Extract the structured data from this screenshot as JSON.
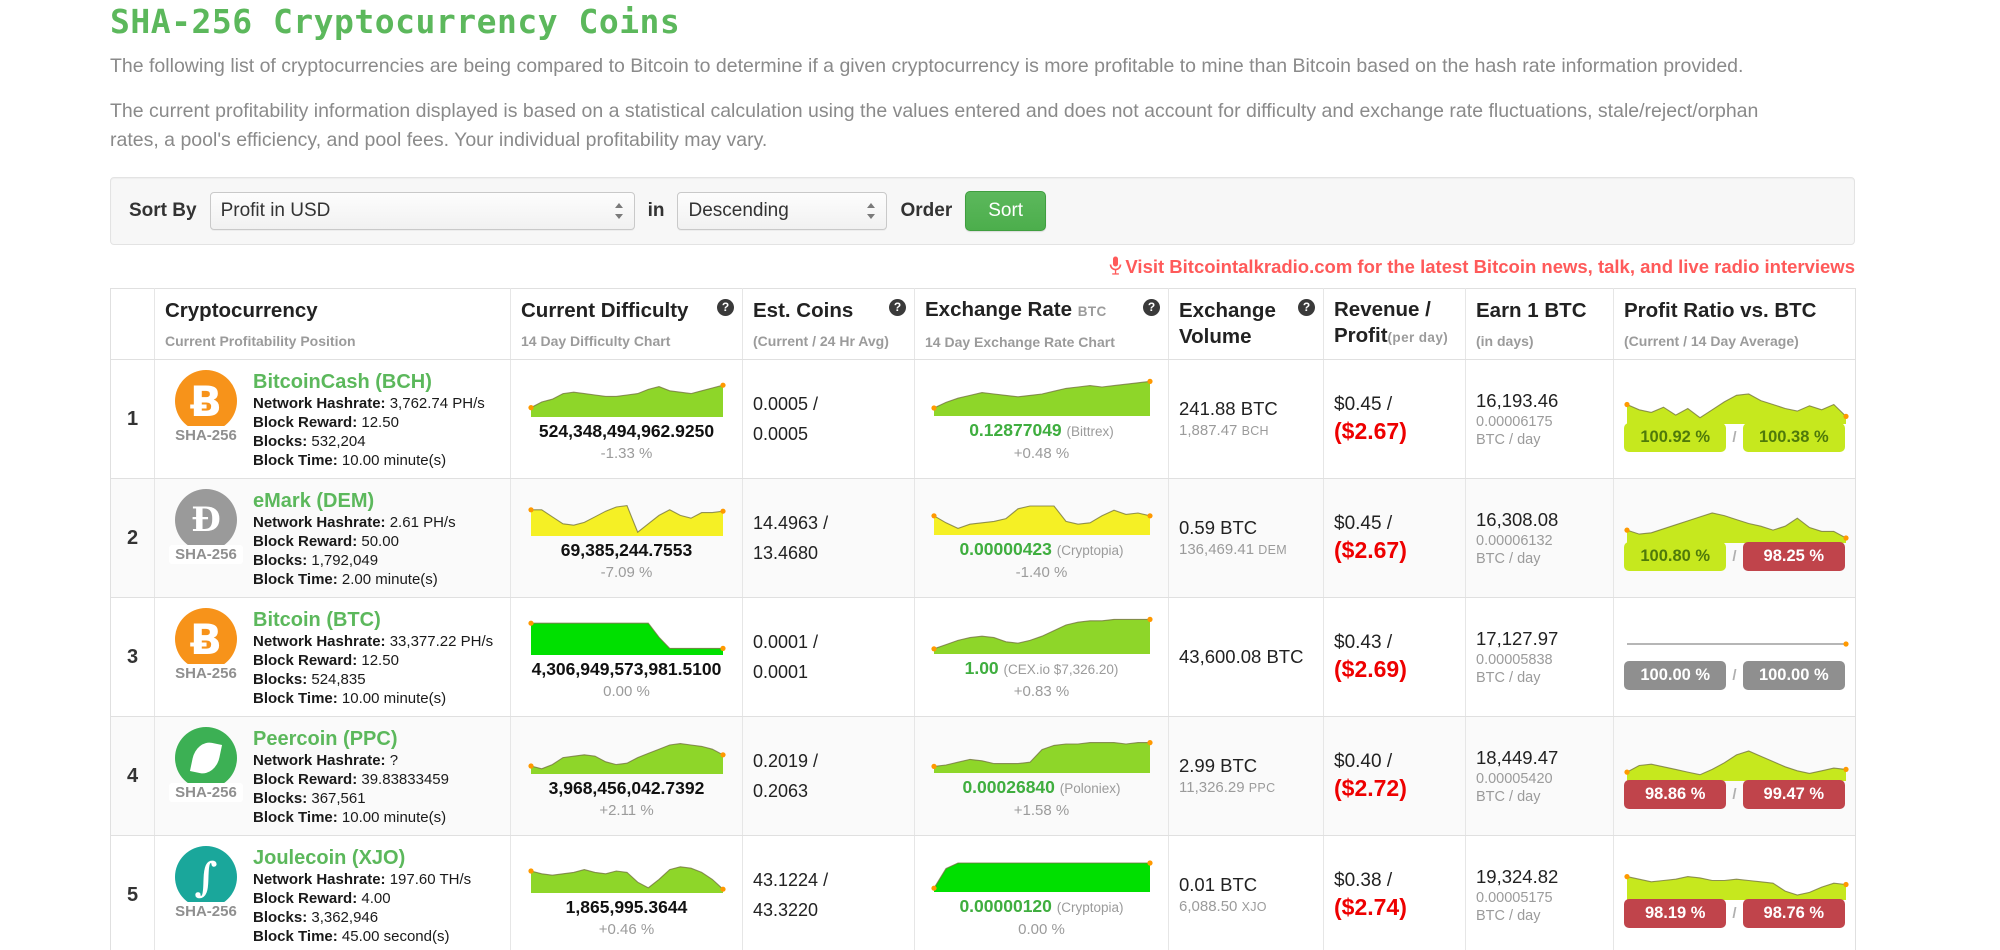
{
  "header": {
    "title": "SHA-256 Cryptocurrency Coins",
    "paragraph_1": "The following list of cryptocurrencies are being compared to Bitcoin to determine if a given cryptocurrency is more profitable to mine than Bitcoin based on the hash rate information provided.",
    "paragraph_2": "The current profitability information displayed is based on a statistical calculation using the values entered and does not account for difficulty and exchange rate fluctuations, stale/reject/orphan rates, a pool's efficiency, and pool fees. Your individual profitability may vary."
  },
  "sort_bar": {
    "sort_by_label": "Sort By",
    "sort_by_value": "Profit in USD",
    "in_label": "in",
    "direction_value": "Descending",
    "order_label": "Order",
    "sort_button": "Sort"
  },
  "promo": {
    "icon": "microphone-icon",
    "text": "Visit Bitcointalkradio.com for the latest Bitcoin news, talk, and live radio interviews",
    "color": "#ff5a5a"
  },
  "table": {
    "columns": [
      {
        "key": "rank",
        "main": "",
        "unit": "",
        "sub": "",
        "help": false
      },
      {
        "key": "coin",
        "main": "Cryptocurrency",
        "unit": "",
        "sub": "Current Profitability Position",
        "help": false
      },
      {
        "key": "diff",
        "main": "Current Difficulty",
        "unit": "",
        "sub": "14 Day Difficulty Chart",
        "help": true
      },
      {
        "key": "coins",
        "main": "Est. Coins",
        "unit": "",
        "sub": "(Current / 24 Hr Avg)",
        "help": true
      },
      {
        "key": "rate",
        "main": "Exchange Rate",
        "unit": "BTC",
        "sub": "14 Day Exchange Rate Chart",
        "help": true
      },
      {
        "key": "vol",
        "main": "Exchange Volume",
        "unit": "",
        "sub": "",
        "help": true
      },
      {
        "key": "rev",
        "main": "Revenue /\nProfit",
        "unit": "(per day)",
        "sub": "",
        "help": false
      },
      {
        "key": "earn",
        "main": "Earn 1 BTC",
        "unit": "",
        "sub": "(in days)",
        "help": false
      },
      {
        "key": "ratio",
        "main": "Profit Ratio vs. BTC",
        "unit": "",
        "sub": "(Current / 14 Day Average)",
        "help": false
      }
    ],
    "rows": [
      {
        "rank": "1",
        "coin": {
          "name": "BitcoinCash (BCH)",
          "icon": "bitcoin-cash-coin-icon",
          "icon_class": "btc",
          "glyph": "Ƀ",
          "algo": "SHA-256",
          "hashrate_label": "Network Hashrate:",
          "hashrate_value": "3,762.74 PH/s",
          "reward_label": "Block Reward:",
          "reward_value": "12.50",
          "blocks_label": "Blocks:",
          "blocks_value": "532,204",
          "time_label": "Block Time:",
          "time_value": "10.00 minute(s)"
        },
        "difficulty": {
          "value": "524,348,494,962.9250",
          "pct": "-1.33 %",
          "color": "#8ed629",
          "points": [
            6,
            10,
            12,
            16,
            17,
            16,
            15,
            14,
            14,
            15,
            16,
            19,
            21,
            18,
            17,
            16,
            18,
            20,
            22
          ]
        },
        "est_coins": {
          "current": "0.0005 /",
          "avg": "0.0005"
        },
        "exchange_rate": {
          "value": "0.12877049",
          "source": "(Bittrex)",
          "pct": "+0.48 %",
          "color": "#8ed629",
          "points": [
            5,
            9,
            12,
            14,
            16,
            15,
            14,
            13,
            14,
            15,
            17,
            19,
            20,
            21,
            20,
            21,
            22,
            23,
            24
          ]
        },
        "volume": {
          "btc": "241.88 BTC",
          "coin_amount": "1,887.47",
          "coin_ticker": "BCH"
        },
        "revenue": {
          "top": "$0.45 /",
          "bottom": "($2.67)"
        },
        "earn": {
          "days": "16,193.46",
          "rate": "0.00006175",
          "unit": "BTC / day"
        },
        "ratio": {
          "current": "100.92 %",
          "average": "100.38 %",
          "current_state": "up",
          "average_state": "up",
          "points": [
            14,
            10,
            8,
            12,
            6,
            11,
            4,
            10,
            16,
            21,
            22,
            17,
            14,
            11,
            9,
            13,
            10,
            14,
            5
          ]
        }
      },
      {
        "rank": "2",
        "coin": {
          "name": "eMark (DEM)",
          "icon": "emark-coin-icon",
          "icon_class": "dem",
          "glyph": "Ð",
          "algo": "SHA-256",
          "hashrate_label": "Network Hashrate:",
          "hashrate_value": "2.61 PH/s",
          "reward_label": "Block Reward:",
          "reward_value": "50.00",
          "blocks_label": "Blocks:",
          "blocks_value": "1,792,049",
          "time_label": "Block Time:",
          "time_value": "2.00 minute(s)"
        },
        "difficulty": {
          "value": "69,385,244.7553",
          "pct": "-7.09 %",
          "color": "#f5f025",
          "points": [
            18,
            18,
            13,
            8,
            7,
            9,
            13,
            17,
            20,
            21,
            2,
            8,
            14,
            18,
            14,
            12,
            16,
            16,
            17
          ]
        },
        "est_coins": {
          "current": "14.4963 /",
          "avg": "13.4680"
        },
        "exchange_rate": {
          "value": "0.00000423",
          "source": "(Cryptopia)",
          "pct": "-1.40 %",
          "color": "#f5f025",
          "points": [
            13,
            8,
            4,
            7,
            8,
            9,
            11,
            18,
            20,
            20,
            20,
            9,
            7,
            8,
            13,
            17,
            14,
            15,
            13
          ]
        },
        "volume": {
          "btc": "0.59 BTC",
          "coin_amount": "136,469.41",
          "coin_ticker": "DEM"
        },
        "revenue": {
          "top": "$0.45 /",
          "bottom": "($2.67)"
        },
        "earn": {
          "days": "16,308.08",
          "rate": "0.00006132",
          "unit": "BTC / day"
        },
        "ratio": {
          "current": "100.80 %",
          "average": "98.25 %",
          "current_state": "up",
          "average_state": "down",
          "points": [
            9,
            6,
            7,
            10,
            13,
            16,
            19,
            22,
            20,
            17,
            14,
            12,
            9,
            12,
            18,
            11,
            8,
            8,
            3
          ]
        }
      },
      {
        "rank": "3",
        "coin": {
          "name": "Bitcoin (BTC)",
          "icon": "bitcoin-coin-icon",
          "icon_class": "btc",
          "glyph": "Ƀ",
          "algo": "SHA-256",
          "hashrate_label": "Network Hashrate:",
          "hashrate_value": "33,377.22 PH/s",
          "reward_label": "Block Reward:",
          "reward_value": "12.50",
          "blocks_label": "Blocks:",
          "blocks_value": "524,835",
          "time_label": "Block Time:",
          "time_value": "10.00 minute(s)"
        },
        "difficulty": {
          "value": "4,306,949,573,981.5100",
          "pct": "0.00 %",
          "color": "#00e000",
          "points": [
            22,
            22,
            22,
            22,
            22,
            22,
            22,
            22,
            22,
            22,
            22,
            22,
            12,
            4,
            4,
            4,
            4,
            4,
            4
          ]
        },
        "est_coins": {
          "current": "0.0001 /",
          "avg": "0.0001"
        },
        "exchange_rate": {
          "value": "1.00",
          "source": "(CEX.io $7,326.20)",
          "pct": "+0.83 %",
          "color": "#8ed629",
          "points": [
            3,
            6,
            9,
            11,
            12,
            11,
            8,
            7,
            9,
            12,
            16,
            20,
            22,
            23,
            23,
            24,
            24,
            24,
            24
          ]
        },
        "volume": {
          "btc": "43,600.08 BTC",
          "coin_amount": "",
          "coin_ticker": ""
        },
        "revenue": {
          "top": "$0.43 /",
          "bottom": "($2.69)"
        },
        "earn": {
          "days": "17,127.97",
          "rate": "0.00005838",
          "unit": "BTC / day"
        },
        "ratio": {
          "current": "100.00 %",
          "average": "100.00 %",
          "current_state": "flat",
          "average_state": "flat",
          "points": [
            13,
            13,
            13,
            13,
            13,
            13,
            13,
            13,
            13,
            13,
            13,
            13,
            13,
            13,
            13,
            13,
            13,
            13,
            13
          ]
        }
      },
      {
        "rank": "4",
        "coin": {
          "name": "Peercoin (PPC)",
          "icon": "peercoin-coin-icon",
          "icon_class": "ppc",
          "glyph": "",
          "algo": "SHA-256",
          "hashrate_label": "Network Hashrate:",
          "hashrate_value": "?",
          "reward_label": "Block Reward:",
          "reward_value": "39.83833459",
          "blocks_label": "Blocks:",
          "blocks_value": "367,561",
          "time_label": "Block Time:",
          "time_value": "10.00 minute(s)"
        },
        "difficulty": {
          "value": "3,968,456,042.7392",
          "pct": "+2.11 %",
          "color": "#8ed629",
          "points": [
            5,
            3,
            6,
            11,
            12,
            13,
            12,
            8,
            6,
            7,
            11,
            14,
            17,
            20,
            21,
            20,
            19,
            17,
            13
          ]
        },
        "est_coins": {
          "current": "0.2019 /",
          "avg": "0.2063"
        },
        "exchange_rate": {
          "value": "0.00026840",
          "source": "(Poloniex)",
          "pct": "+1.58 %",
          "color": "#8ed629",
          "points": [
            4,
            5,
            7,
            9,
            8,
            6,
            6,
            6,
            7,
            16,
            19,
            20,
            20,
            21,
            21,
            21,
            20,
            21,
            21
          ]
        },
        "volume": {
          "btc": "2.99 BTC",
          "coin_amount": "11,326.29",
          "coin_ticker": "PPC"
        },
        "revenue": {
          "top": "$0.40 /",
          "bottom": "($2.72)"
        },
        "earn": {
          "days": "18,449.47",
          "rate": "0.00005420",
          "unit": "BTC / day"
        },
        "ratio": {
          "current": "98.86 %",
          "average": "99.47 %",
          "current_state": "down",
          "average_state": "down",
          "points": [
            6,
            11,
            12,
            10,
            8,
            6,
            4,
            8,
            13,
            19,
            22,
            18,
            14,
            10,
            7,
            5,
            7,
            9,
            8
          ]
        }
      },
      {
        "rank": "5",
        "coin": {
          "name": "Joulecoin (XJO)",
          "icon": "joulecoin-coin-icon",
          "icon_class": "xjo",
          "glyph": "∫",
          "algo": "SHA-256",
          "hashrate_label": "Network Hashrate:",
          "hashrate_value": "197.60 TH/s",
          "reward_label": "Block Reward:",
          "reward_value": "4.00",
          "blocks_label": "Blocks:",
          "blocks_value": "3,362,946",
          "time_label": "Block Time:",
          "time_value": "45.00 second(s)"
        },
        "difficulty": {
          "value": "1,865,995.3644",
          "pct": "+0.46 %",
          "color": "#8ed629",
          "points": [
            15,
            13,
            12,
            13,
            14,
            16,
            14,
            13,
            15,
            14,
            7,
            3,
            9,
            16,
            18,
            17,
            14,
            9,
            2
          ]
        },
        "est_coins": {
          "current": "43.1224 /",
          "avg": "43.3220"
        },
        "exchange_rate": {
          "value": "0.00000120",
          "source": "(Cryptopia)",
          "pct": "0.00 %",
          "color": "#00e000",
          "points": [
            2,
            16,
            20,
            20,
            20,
            20,
            20,
            20,
            20,
            20,
            20,
            20,
            20,
            20,
            20,
            20,
            20,
            20,
            20
          ]
        },
        "volume": {
          "btc": "0.01 BTC",
          "coin_amount": "6,088.50",
          "coin_ticker": "XJO"
        },
        "revenue": {
          "top": "$0.38 /",
          "bottom": "($2.74)"
        },
        "earn": {
          "days": "19,324.82",
          "rate": "0.00005175",
          "unit": "BTC / day"
        },
        "ratio": {
          "current": "98.19 %",
          "average": "98.76 %",
          "current_state": "down",
          "average_state": "down",
          "points": [
            17,
            15,
            13,
            14,
            15,
            17,
            16,
            14,
            14,
            15,
            14,
            13,
            12,
            6,
            3,
            5,
            9,
            12,
            11
          ]
        }
      }
    ]
  },
  "colors": {
    "brand_green": "#5cb85c",
    "spark_green": "#8ed629",
    "spark_yellow": "#f5f025",
    "spark_bright_green": "#00e000",
    "badge_up": "#c6e81e",
    "badge_down": "#c0444b",
    "badge_flat": "#8f8f8f",
    "loss_red": "#ee0000",
    "dot_orange": "#ff9900"
  }
}
